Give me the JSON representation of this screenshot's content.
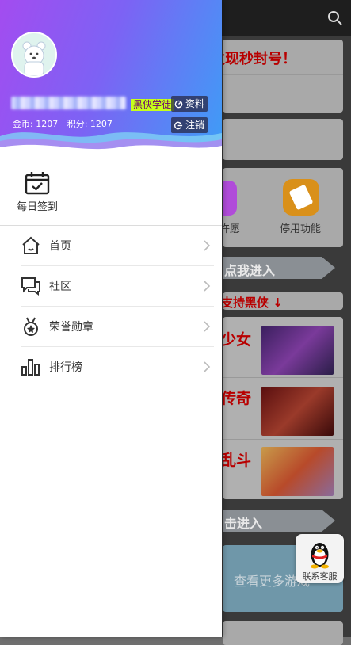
{
  "drawer": {
    "user": {
      "badge": "黑侠学徒",
      "coins_label": "金币: 1207",
      "points_label": "积分: 1207"
    },
    "buttons": {
      "profile": "资料",
      "logout": "注销"
    },
    "checkin": {
      "label": "每日签到"
    },
    "menu": [
      {
        "label": "首页",
        "icon": "home-icon"
      },
      {
        "label": "社区",
        "icon": "chat-icon"
      },
      {
        "label": "荣誉勋章",
        "icon": "medal-icon"
      },
      {
        "label": "排行榜",
        "icon": "bar-chart-icon"
      }
    ]
  },
  "background": {
    "notice": "发现秒封号！",
    "icons": [
      {
        "label": "许愿"
      },
      {
        "label": "停用功能"
      }
    ],
    "banner1": "点我进入",
    "support": "支持黑侠 ↓",
    "games": [
      {
        "title": "少女"
      },
      {
        "title": "传奇"
      },
      {
        "title": "乱斗"
      }
    ],
    "banner2": "击进入",
    "more": "查看更多游戏"
  },
  "service": {
    "label": "联系客服"
  },
  "colors": {
    "header_start": "#a34cf0",
    "header_end": "#3d9ef6",
    "badge_bg": "#c7ff1a",
    "accent_red": "#b80000"
  }
}
